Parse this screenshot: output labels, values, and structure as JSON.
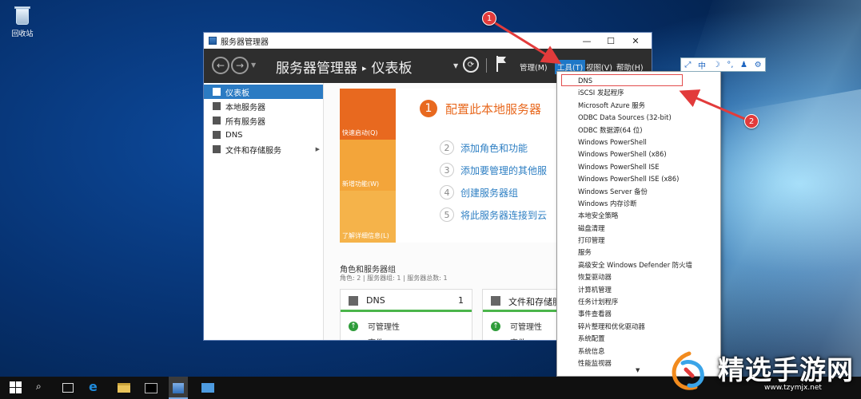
{
  "desktop": {
    "recycle_bin_label": "回收站"
  },
  "window": {
    "title": "服务器管理器",
    "controls": {
      "minimize": "—",
      "maximize": "☐",
      "close": "✕"
    }
  },
  "header": {
    "breadcrumb_app": "服务器管理器",
    "breadcrumb_sep": "▸",
    "breadcrumb_page": "仪表板",
    "menus": {
      "manage": "管理(M)",
      "tools": "工具(T)",
      "view": "视图(V)",
      "help": "帮助(H)"
    }
  },
  "sidebar": {
    "items": [
      {
        "label": "仪表板",
        "icon": "dashboard-icon",
        "active": true
      },
      {
        "label": "本地服务器",
        "icon": "server-icon"
      },
      {
        "label": "所有服务器",
        "icon": "servers-icon"
      },
      {
        "label": "DNS",
        "icon": "dns-icon"
      },
      {
        "label": "文件和存储服务",
        "icon": "storage-icon",
        "expandable": true
      }
    ],
    "expand_glyph": "▶"
  },
  "quick_start": {
    "tiles": [
      "快速启动(Q)",
      "新增功能(W)",
      "了解详细信息(L)"
    ],
    "step1": {
      "num": "1",
      "label": "配置此本地服务器"
    },
    "steps": [
      {
        "num": "2",
        "label": "添加角色和功能"
      },
      {
        "num": "3",
        "label": "添加要管理的其他服"
      },
      {
        "num": "4",
        "label": "创建服务器组"
      },
      {
        "num": "5",
        "label": "将此服务器连接到云"
      }
    ]
  },
  "roles": {
    "title": "角色和服务器组",
    "subtitle": "角色: 2 | 服务器组: 1 | 服务器总数: 1",
    "cards": [
      {
        "title": "DNS",
        "count": "1",
        "manageability": "可管理性",
        "events": "事件"
      },
      {
        "title": "文件和存储服",
        "count": "",
        "manageability": "可管理性",
        "events": "事件"
      }
    ]
  },
  "tools_menu": {
    "items": [
      "DNS",
      "iSCSI 发起程序",
      "Microsoft Azure 服务",
      "ODBC Data Sources (32-bit)",
      "ODBC 数据源(64 位)",
      "Windows PowerShell",
      "Windows PowerShell (x86)",
      "Windows PowerShell ISE",
      "Windows PowerShell ISE (x86)",
      "Windows Server 备份",
      "Windows 内存诊断",
      "本地安全策略",
      "磁盘清理",
      "打印管理",
      "服务",
      "高级安全 Windows Defender 防火墙",
      "恢复驱动器",
      "计算机管理",
      "任务计划程序",
      "事件查看器",
      "碎片整理和优化驱动器",
      "系统配置",
      "系统信息",
      "性能监视器"
    ],
    "scroll_glyph": "▼"
  },
  "float_toolbar": {
    "items": [
      "⤢",
      "中",
      "☽",
      "°,",
      "♟",
      "⚙"
    ]
  },
  "annotations": {
    "badge1": "1",
    "badge2": "2",
    "color": "#e23b3b"
  },
  "watermark": {
    "text": "精选手游网",
    "url": "www.tzymjx.net"
  },
  "colors": {
    "accent_blue": "#2b7bc3",
    "quick_start_orange": "#e8691f",
    "status_green": "#4bb54b",
    "header_dark": "#2e2e2e"
  }
}
